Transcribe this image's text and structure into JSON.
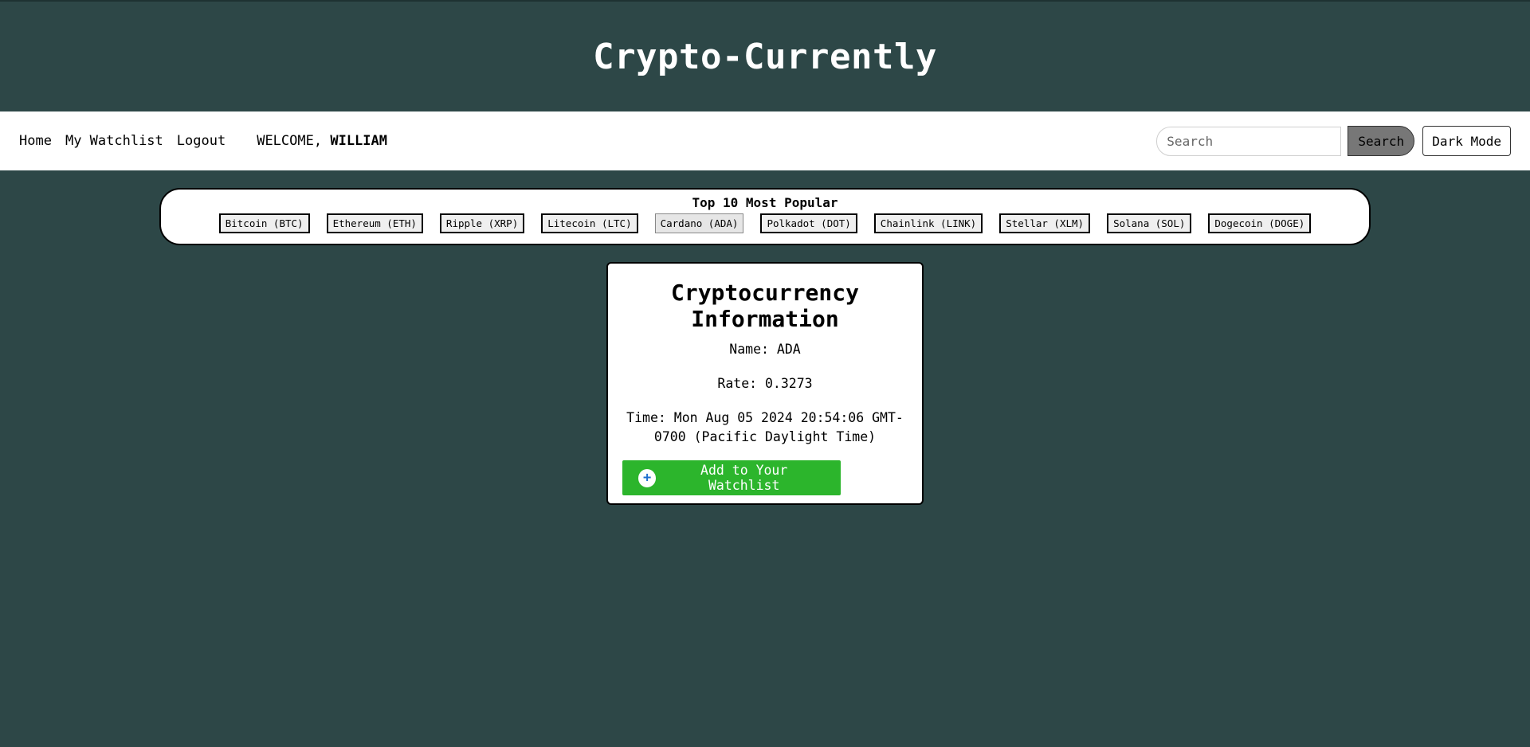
{
  "header": {
    "title": "Crypto-Currently"
  },
  "nav": {
    "links": [
      "Home",
      "My Watchlist",
      "Logout"
    ],
    "welcome_prefix": "WELCOME,",
    "user_name": "WILLIAM",
    "search_placeholder": "Search",
    "search_label": "Search",
    "dark_mode_label": "Dark Mode"
  },
  "popular": {
    "title": "Top 10 Most Popular",
    "coins": [
      "Bitcoin (BTC)",
      "Ethereum (ETH)",
      "Ripple (XRP)",
      "Litecoin (LTC)",
      "Cardano (ADA)",
      "Polkadot (DOT)",
      "Chainlink (LINK)",
      "Stellar (XLM)",
      "Solana (SOL)",
      "Dogecoin (DOGE)"
    ],
    "selected": "Cardano (ADA)"
  },
  "card": {
    "title": "Cryptocurrency Information",
    "name": "Name: ADA",
    "rate": "Rate: 0.3273",
    "time": "Time: Mon Aug 05 2024 20:54:06 GMT-0700 (Pacific Daylight Time)",
    "add_label": "Add to Your Watchlist",
    "add_icon": "plus-circle-icon"
  },
  "colors": {
    "background": "#2d4747",
    "add_button": "#2cb52c",
    "search_button": "#777777",
    "plus_icon": "#1f6fd0"
  }
}
